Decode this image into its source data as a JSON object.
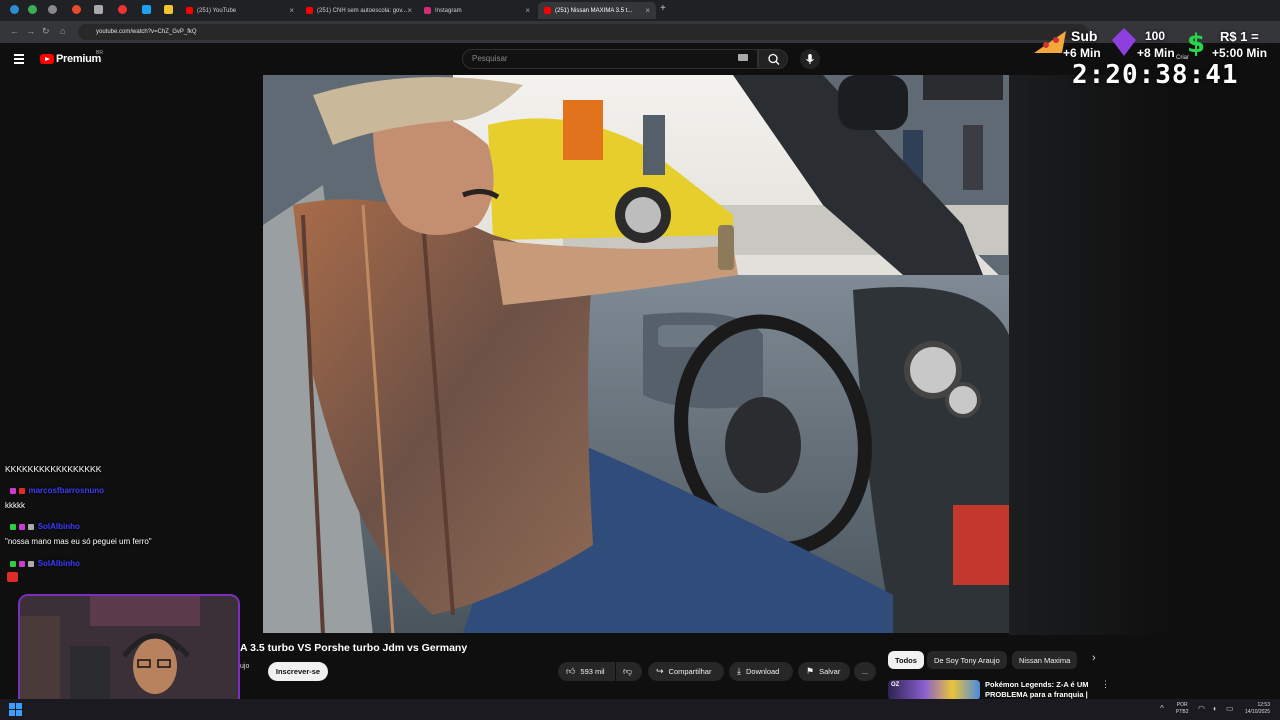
{
  "browser": {
    "tabs": [
      {
        "title": "(251) YouTube",
        "color": "#ff0000",
        "active": false
      },
      {
        "title": "(251) CNH sem autoescola: gov...",
        "color": "#ff0000",
        "active": false
      },
      {
        "title": "Instagram",
        "color": "#d62976",
        "active": false
      },
      {
        "title": "(251) Nissan MAXIMA 3.5 t...",
        "color": "#ff0000",
        "active": true
      }
    ],
    "url": "youtube.com/watch?v=ChZ_GvP_fkQ"
  },
  "youtube": {
    "logo_text": "Premium",
    "region": "BR",
    "search_placeholder": "Pesquisar"
  },
  "overlay": {
    "sub_label": "Sub",
    "sub_time": "+6 Min",
    "gem_count": "100",
    "gem_time": "+8 Min",
    "money_label": "R$ 1 =",
    "money_time": "+5:00 Min",
    "create_label": "Criar",
    "timer": "2:20:38:41"
  },
  "chat": [
    {
      "user": "",
      "text": "KKKKKKKKKKKKKKKKK"
    },
    {
      "user": "marcosfbarrosnuno",
      "text": "kkkkk"
    },
    {
      "user": "SolAlbinho",
      "text": "\"nossa mano mas eu só peguei um ferro\""
    },
    {
      "user": "SolAlbinho",
      "text": ""
    }
  ],
  "video": {
    "title": "A 3.5 turbo VS Porshe turbo Jdm vs Germany",
    "channel": "ujo",
    "subscribe_label": "Inscrever-se",
    "likes": "593 mil",
    "share_label": "Compartilhar",
    "download_label": "Download",
    "save_label": "Salvar",
    "more_label": "..."
  },
  "chips": [
    "Todos",
    "De Soy Tony Araujo",
    "Nissan Maxima"
  ],
  "recommendation": {
    "thumb_tag": "OZ",
    "title": "Pokémon Legends: Z-A é UM PROBLEMA para a franquia |"
  },
  "taskbar": {
    "lang": "POR",
    "layout": "PTB2",
    "time": "12:53",
    "date": "14/10/2025"
  }
}
